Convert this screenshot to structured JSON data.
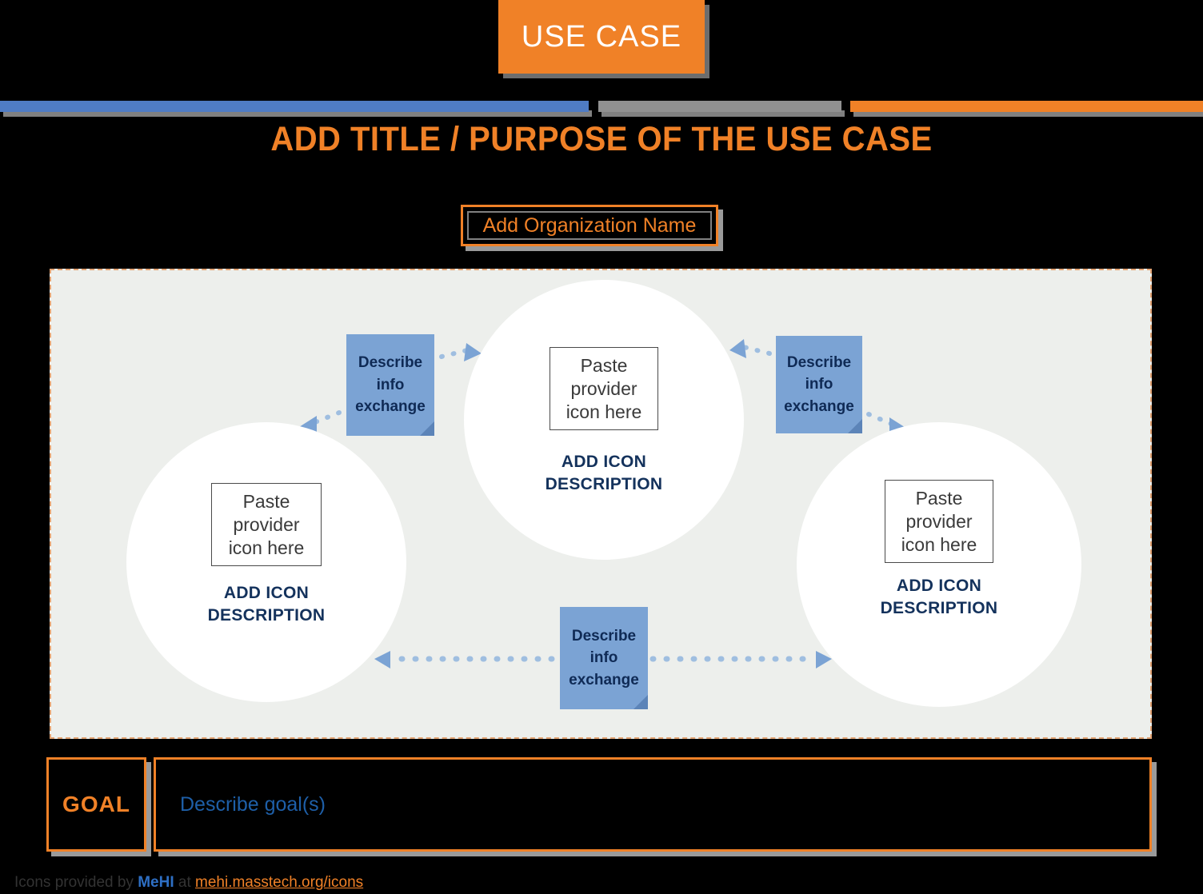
{
  "header": {
    "tab_label": "USE CASE",
    "tab_color": "#F08127",
    "rule_segments": [
      {
        "name": "blue",
        "color": "#4F7CC4"
      },
      {
        "name": "gray",
        "color": "#919191"
      },
      {
        "name": "orange",
        "color": "#F08127"
      }
    ]
  },
  "title": {
    "text": "ADD TITLE / PURPOSE OF THE USE CASE",
    "color": "#F08127"
  },
  "organization": {
    "label": "Add Organization Name",
    "border_color": "#F08127",
    "text_color": "#F08127"
  },
  "diagram": {
    "background": "#EDEFEC",
    "border_color": "#E3A373",
    "nodes": [
      {
        "id": "center",
        "icon_placeholder": "Paste provider icon here",
        "description": "ADD ICON DESCRIPTION"
      },
      {
        "id": "left",
        "icon_placeholder": "Paste provider icon here",
        "description": "ADD ICON DESCRIPTION"
      },
      {
        "id": "right",
        "icon_placeholder": "Paste provider icon here",
        "description": "ADD ICON DESCRIPTION"
      }
    ],
    "notes": [
      {
        "id": "left",
        "text": "Describe info exchange",
        "color": "#7BA3D4"
      },
      {
        "id": "right",
        "text": "Describe info exchange",
        "color": "#7BA3D4"
      },
      {
        "id": "bottom",
        "text": "Describe info exchange",
        "color": "#7BA3D4"
      }
    ],
    "note_lines": {
      "line1": "Describe",
      "line2": "info",
      "line3": "exchange"
    },
    "icon_lines": {
      "line1": "Paste",
      "line2": "provider",
      "line3": "icon here"
    },
    "label_lines": {
      "line1": "ADD ICON",
      "line2": "DESCRIPTION"
    }
  },
  "goal": {
    "label": "GOAL",
    "description": "Describe goal(s)",
    "label_color": "#F08127",
    "description_color": "#1E5FA8"
  },
  "footer": {
    "prefix": "Icons provided by ",
    "brand": "MeHI",
    "middle": " at ",
    "url": "mehi.masstech.org/icons"
  }
}
